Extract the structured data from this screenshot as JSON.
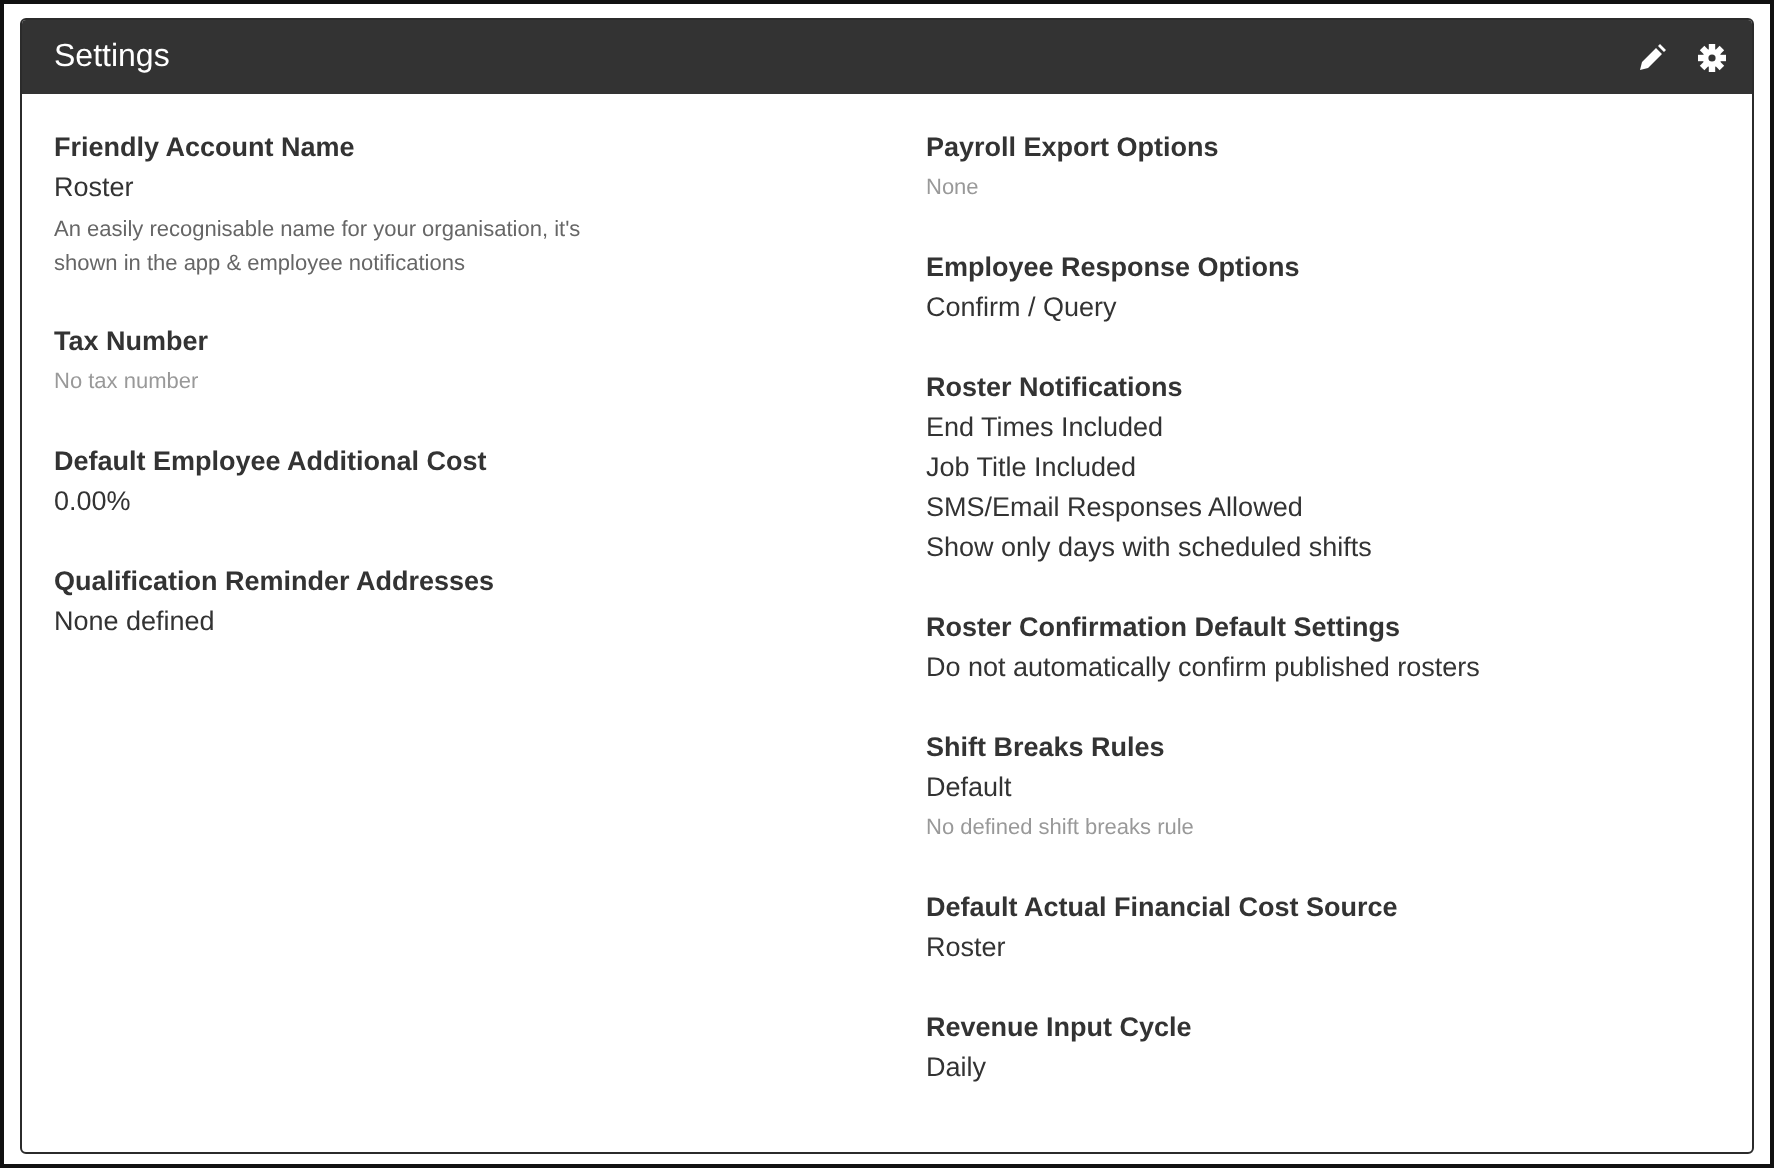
{
  "panel": {
    "title": "Settings"
  },
  "columns": [
    {
      "groups": [
        {
          "heading": "Friendly Account Name",
          "lines": [
            {
              "kind": "value",
              "text": "Roster"
            },
            {
              "kind": "hint",
              "text": "An easily recognisable name for your organisation, it's shown in the app & employee notifications"
            }
          ]
        },
        {
          "heading": "Tax Number",
          "lines": [
            {
              "kind": "empty",
              "text": "No tax number"
            }
          ]
        },
        {
          "heading": "Default Employee Additional Cost",
          "lines": [
            {
              "kind": "value",
              "text": "0.00%"
            }
          ]
        },
        {
          "heading": "Qualification Reminder Addresses",
          "lines": [
            {
              "kind": "value",
              "text": "None defined"
            }
          ]
        }
      ]
    },
    {
      "groups": [
        {
          "heading": "Payroll Export Options",
          "lines": [
            {
              "kind": "empty",
              "text": "None"
            }
          ]
        },
        {
          "heading": "Employee Response Options",
          "lines": [
            {
              "kind": "value",
              "text": "Confirm / Query"
            }
          ]
        },
        {
          "heading": "Roster Notifications",
          "lines": [
            {
              "kind": "value",
              "text": "End Times Included"
            },
            {
              "kind": "value",
              "text": "Job Title Included"
            },
            {
              "kind": "value",
              "text": "SMS/Email Responses Allowed"
            },
            {
              "kind": "value",
              "text": "Show only days with scheduled shifts"
            }
          ]
        },
        {
          "heading": "Roster Confirmation Default Settings",
          "lines": [
            {
              "kind": "value",
              "text": "Do not automatically confirm published rosters"
            }
          ]
        },
        {
          "heading": "Shift Breaks Rules",
          "lines": [
            {
              "kind": "value",
              "text": "Default"
            },
            {
              "kind": "empty",
              "text": "No defined shift breaks rule"
            }
          ]
        },
        {
          "heading": "Default Actual Financial Cost Source",
          "lines": [
            {
              "kind": "value",
              "text": "Roster"
            }
          ]
        },
        {
          "heading": "Revenue Input Cycle",
          "lines": [
            {
              "kind": "value",
              "text": "Daily"
            }
          ]
        }
      ]
    }
  ]
}
